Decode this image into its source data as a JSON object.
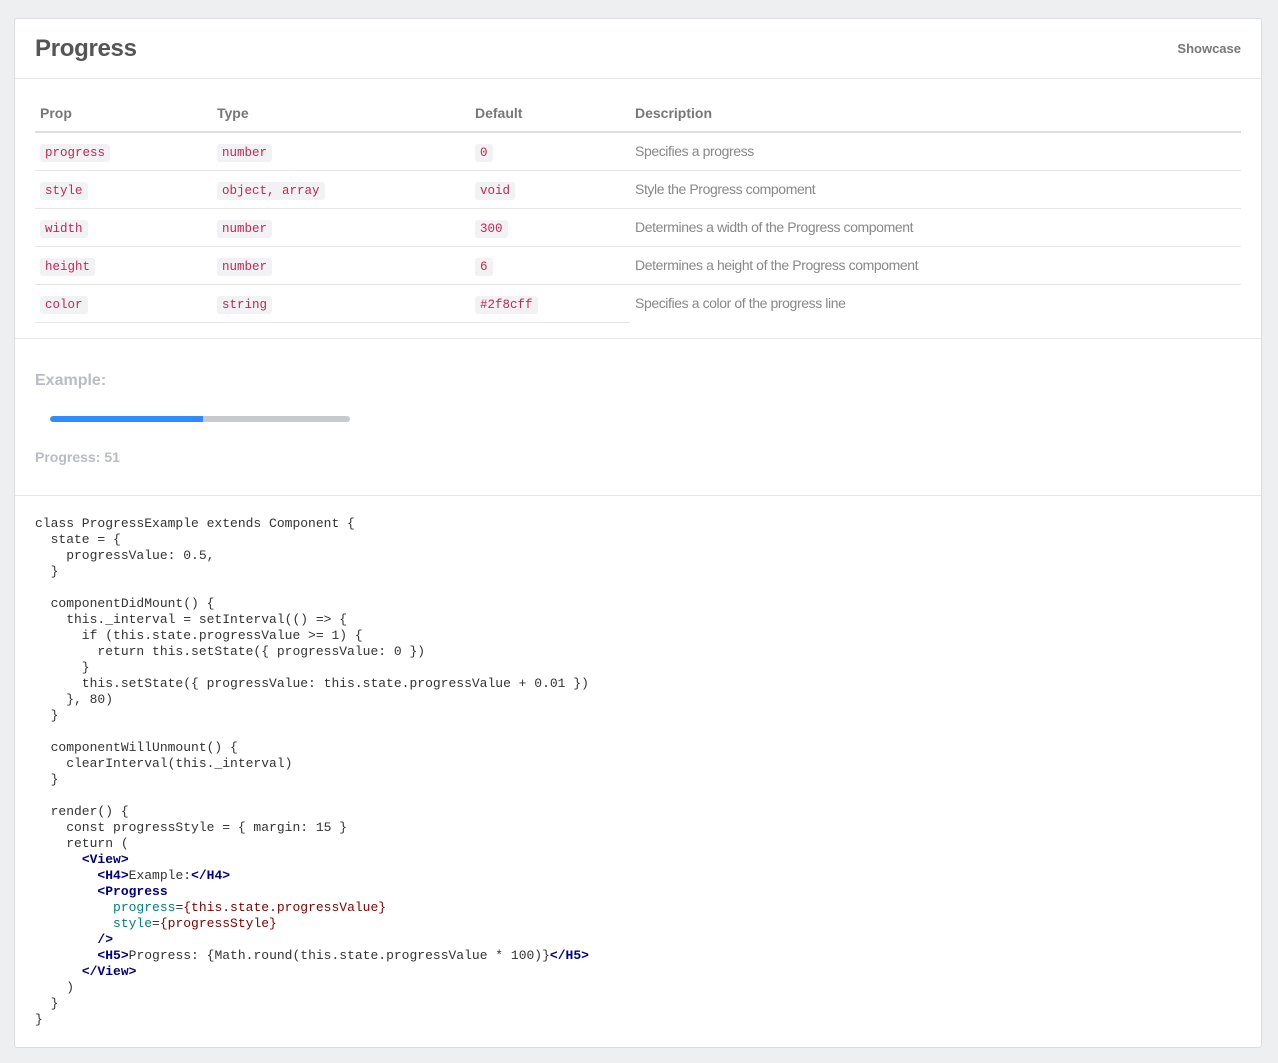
{
  "header": {
    "title": "Progress",
    "showcase_label": "Showcase"
  },
  "table": {
    "columns": [
      "Prop",
      "Type",
      "Default",
      "Description"
    ],
    "rows": [
      {
        "prop": "progress",
        "type": "number",
        "default": "0",
        "description": "Specifies a progress"
      },
      {
        "prop": "style",
        "type": "object, array",
        "default": "void",
        "description": "Style the Progress compoment"
      },
      {
        "prop": "width",
        "type": "number",
        "default": "300",
        "description": "Determines a width of the Progress compoment"
      },
      {
        "prop": "height",
        "type": "number",
        "default": "6",
        "description": "Determines a height of the Progress compoment"
      },
      {
        "prop": "color",
        "type": "string",
        "default": "#2f8cff",
        "description": "Specifies a color of the progress line"
      }
    ]
  },
  "example": {
    "title": "Example:",
    "progress_label": "Progress:",
    "progress_value": "51",
    "progress_fraction": 0.51,
    "bar_color": "#2f8cff",
    "track_color": "#c8c9cc"
  },
  "code": {
    "lines": [
      "class ProgressExample extends Component {",
      "  state = {",
      "    progressValue: 0.5,",
      "  }",
      "",
      "  componentDidMount() {",
      "    this._interval = setInterval(() => {",
      "      if (this.state.progressValue >= 1) {",
      "        return this.setState({ progressValue: 0 })",
      "      }",
      "      this.setState({ progressValue: this.state.progressValue + 0.01 })",
      "    }, 80)",
      "  }",
      "",
      "  componentWillUnmount() {",
      "    clearInterval(this._interval)",
      "  }",
      "",
      "  render() {",
      "    const progressStyle = { margin: 15 }",
      "    return (",
      "      <View>",
      "        <H4>Example:</H4>",
      "        <Progress",
      "          progress={this.state.progressValue}",
      "          style={progressStyle}",
      "        />",
      "        <H5>Progress: {Math.round(this.state.progressValue * 100)}</H5>",
      "      </View>",
      "    )",
      "  }",
      "}"
    ]
  }
}
